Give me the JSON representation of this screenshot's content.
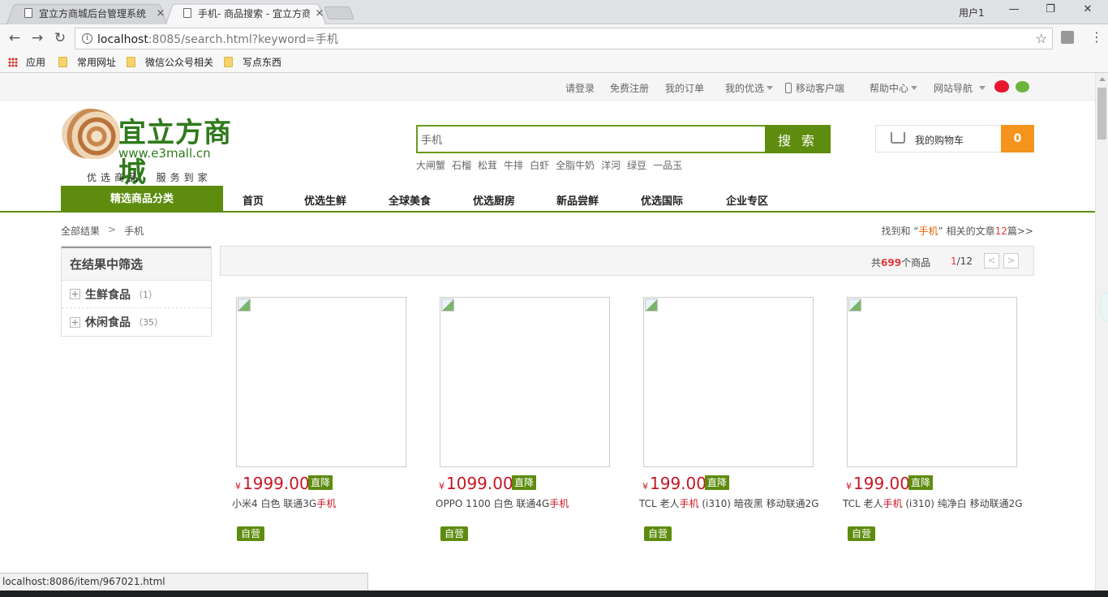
{
  "browser": {
    "tabs": [
      {
        "title": "宜立方商城后台管理系统",
        "close": "×"
      },
      {
        "title": "手机- 商品搜索 - 宜立方商城",
        "close": "×"
      }
    ],
    "window_user": "用户1",
    "window_buttons": {
      "minimize": "—",
      "restore": "❐",
      "close": "✕"
    },
    "url_host": "localhost",
    "url_rest": ":8085/search.html?keyword=手机",
    "bookmarks": [
      {
        "label": "应用"
      },
      {
        "label": "常用网址"
      },
      {
        "label": "微信公众号相关"
      },
      {
        "label": "写点东西"
      }
    ],
    "status_url": "localhost:8086/item/967021.html"
  },
  "topbar": {
    "login": "请登录",
    "register": "免费注册",
    "orders": "我的订单",
    "my_selection": "我的优选",
    "mobile": "移动客户端",
    "help": "帮助中心",
    "site_nav": "网站导航"
  },
  "header": {
    "brand": "宜立方商城",
    "domain": "www.e3mall.cn",
    "slogan": "优选商品  服务到家",
    "search_value": "手机",
    "search_button": "搜 索",
    "hotwords": [
      "大闸蟹",
      "石榴",
      "松茸",
      "牛排",
      "白虾",
      "全脂牛奶",
      "洋河",
      "绿豆",
      "一品玉"
    ],
    "cart_label": "我的购物车",
    "cart_count": "0"
  },
  "nav": {
    "all_categories": "精选商品分类",
    "items": [
      "首页",
      "优选生鲜",
      "全球美食",
      "优选厨房",
      "新品尝鲜",
      "优选国际",
      "企业专区"
    ]
  },
  "breadcrumb": {
    "root": "全部结果",
    "sep": ">",
    "current": "手机"
  },
  "result_note": {
    "prefix": "找到和 “",
    "keyword": "手机",
    "middle": "” 相关的文章",
    "count": "12",
    "suffix": "篇>>"
  },
  "filter": {
    "title": "在结果中筛选",
    "items": [
      {
        "label": "生鲜食品",
        "count": "（1）"
      },
      {
        "label": "休闲食品",
        "count": "（35）"
      }
    ]
  },
  "sortbar": {
    "total_prefix": "共",
    "total": "699",
    "total_suffix": "个商品",
    "page_current": "1",
    "page_total": "/12",
    "prev": "<",
    "next": ">"
  },
  "products": [
    {
      "price": "1999.00",
      "sale_tag": "直降",
      "name_a": "小米4 白色 联通3G",
      "name_hl": "手机",
      "name_b": "",
      "self_tag": "自营"
    },
    {
      "price": "1099.00",
      "sale_tag": "直降",
      "name_a": "OPPO 1100 白色 联通4G",
      "name_hl": "手机",
      "name_b": "",
      "self_tag": "自营"
    },
    {
      "price": "199.00",
      "sale_tag": "直降",
      "name_a": "TCL 老人",
      "name_hl": "手机",
      "name_b": " (i310) 暗夜黑 移动联通2G",
      "self_tag": "自营"
    },
    {
      "price": "199.00",
      "sale_tag": "直降",
      "name_a": "TCL 老人",
      "name_hl": "手机",
      "name_b": " (i310) 纯净白 移动联通2G",
      "self_tag": "自营"
    }
  ],
  "currency": "¥",
  "colors": {
    "brand_green": "#5d8c0e",
    "price_red": "#c81623",
    "cart_orange": "#f5941d"
  }
}
